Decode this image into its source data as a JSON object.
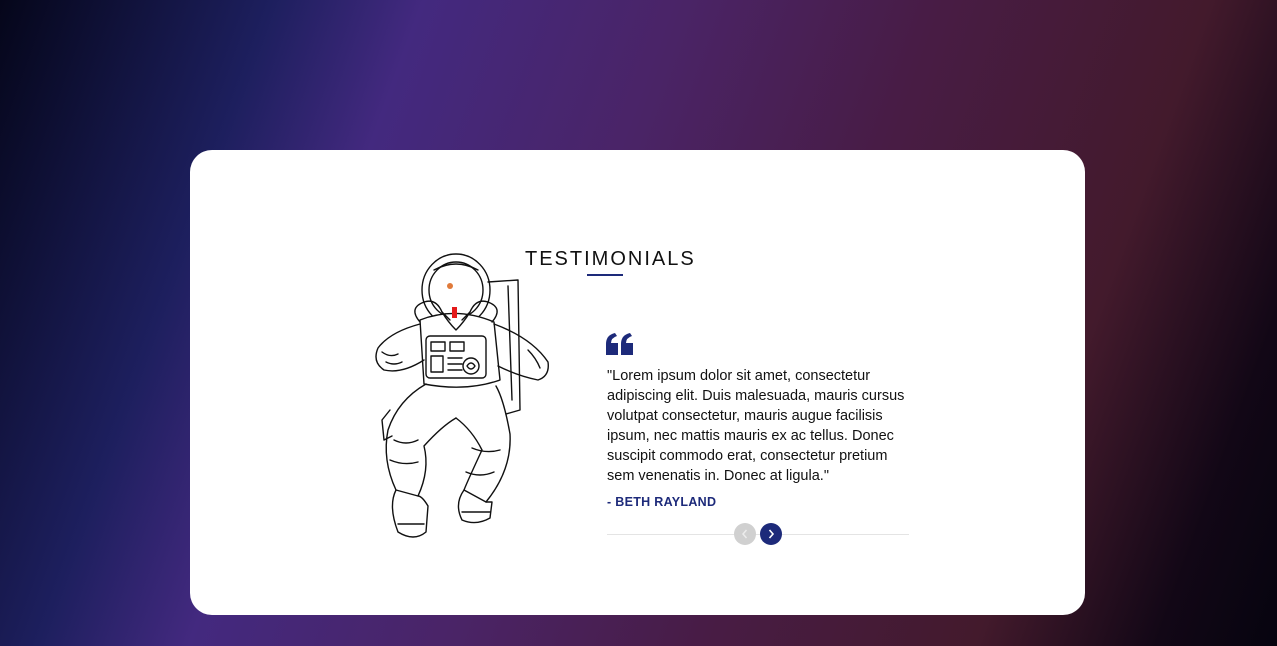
{
  "section": {
    "title": "TESTIMONIALS"
  },
  "testimonial": {
    "quote": "\"Lorem ipsum dolor sit amet, consectetur adipiscing elit. Duis malesuada, mauris cursus volutpat consectetur, mauris augue facilisis ipsum, nec mattis mauris ex ac tellus. Donec suscipit commodo erat, consectetur pretium sem venenatis in. Donec at ligula.\"",
    "author": "- BETH RAYLAND"
  },
  "icons": {
    "quote": "quote-icon",
    "prev": "chevron-left-icon",
    "next": "chevron-right-icon",
    "illustration": "astronaut-illustration"
  },
  "colors": {
    "accent": "#1d2a7a",
    "disabled": "#d0d0d0",
    "card": "#ffffff"
  }
}
